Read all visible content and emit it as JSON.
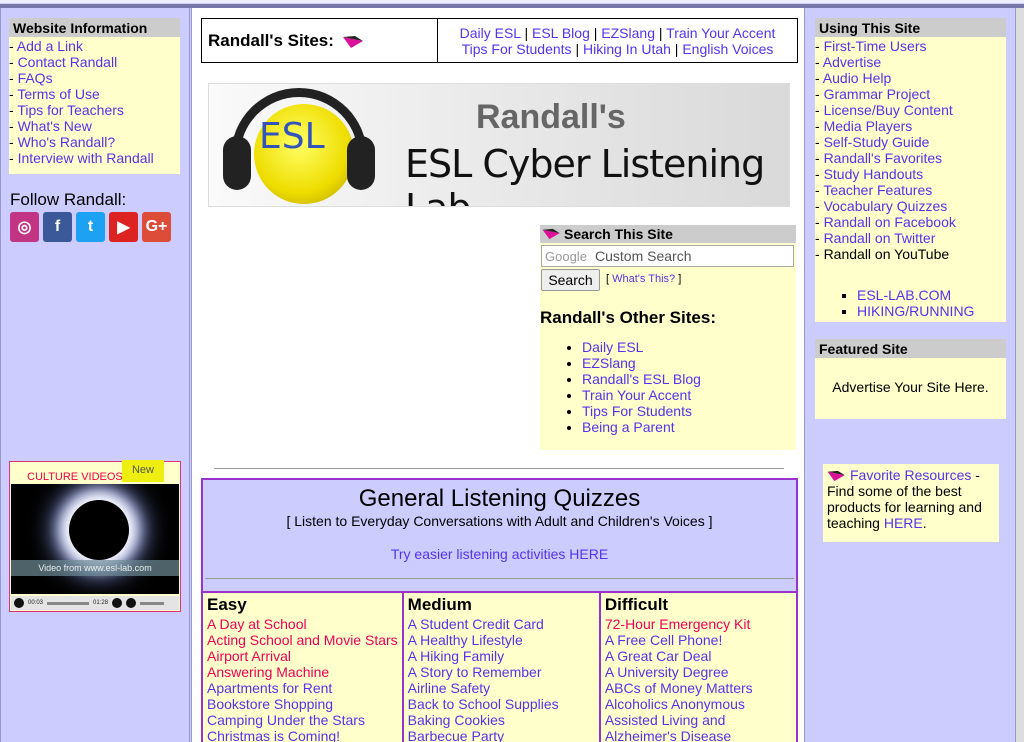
{
  "colors": {
    "page_bg": "#ccccff",
    "link": "#5533ee",
    "pink_link": "#ee0055",
    "yellow": "#ffffcc",
    "header_gray": "#cccccc",
    "quiz_border": "#9933cc"
  },
  "left": {
    "website_info": {
      "heading": "Website Information",
      "items": [
        "Add a Link",
        "Contact Randall",
        "FAQs",
        "Terms of Use",
        "Tips for Teachers",
        "What's New",
        "Who's Randall?",
        "Interview with Randall"
      ]
    },
    "follow_label": "Follow Randall:",
    "social_icons": [
      {
        "name": "instagram-icon",
        "glyph": "◎",
        "color": "#c13584"
      },
      {
        "name": "facebook-icon",
        "glyph": "f",
        "color": "#3b5998"
      },
      {
        "name": "twitter-icon",
        "glyph": "t",
        "color": "#1da1f2"
      },
      {
        "name": "youtube-icon",
        "glyph": "▶",
        "color": "#dd2222"
      },
      {
        "name": "googleplus-icon",
        "glyph": "G+",
        "color": "#dd4b39"
      }
    ],
    "video": {
      "label": "CULTURE VIDEOS",
      "badge": "New",
      "caption": "Video from www.esl-lab.com",
      "time_current": "00:03",
      "time_total": "01:28"
    }
  },
  "center": {
    "sites_title": "Randall's Sites",
    "sites_links_row1": [
      "Daily ESL",
      "ESL Blog",
      "EZSlang",
      "Train Your Accent"
    ],
    "sites_links_row2": [
      "Tips For Students",
      "Hiking In Utah",
      "English Voices"
    ],
    "banner": {
      "esl": "ESL",
      "randall": "Randall's",
      "title": "ESL Cyber Listening Lab"
    },
    "search": {
      "heading": "Search This Site",
      "google": "Google",
      "placeholder": "Custom Search",
      "button": "Search",
      "whats_this": "What's This?"
    },
    "other_sites": {
      "heading": "Randall's Other Sites:",
      "items": [
        "Daily ESL",
        "EZSlang",
        "Randall's ESL Blog",
        "Train Your Accent",
        "Tips For Students",
        "Being a Parent"
      ]
    },
    "quizzes": {
      "title": "General Listening Quizzes",
      "subtitle": "[ Listen to Everyday Conversations with Adult and Children's Voices ]",
      "easier": "Try easier listening activities HERE",
      "columns": [
        {
          "heading": "Easy",
          "items": [
            {
              "t": "A Day at School",
              "pink": true
            },
            {
              "t": "Acting School and Movie Stars",
              "pink": true
            },
            {
              "t": "Airport Arrival",
              "pink": true
            },
            {
              "t": "Answering Machine",
              "pink": true
            },
            {
              "t": "Apartments for Rent",
              "pink": false
            },
            {
              "t": "Bookstore Shopping",
              "pink": false
            },
            {
              "t": "Camping Under the Stars",
              "pink": false
            },
            {
              "t": "Christmas is Coming!",
              "pink": false
            }
          ]
        },
        {
          "heading": "Medium",
          "items": [
            {
              "t": "A Student Credit Card",
              "pink": false
            },
            {
              "t": "A Healthy Lifestyle",
              "pink": false
            },
            {
              "t": "A Hiking Family",
              "pink": false
            },
            {
              "t": "A Story to Remember",
              "pink": false
            },
            {
              "t": "Airline Safety",
              "pink": false
            },
            {
              "t": "Back to School Supplies",
              "pink": false
            },
            {
              "t": "Baking Cookies",
              "pink": false
            },
            {
              "t": "Barbecue Party",
              "pink": false
            }
          ]
        },
        {
          "heading": "Difficult",
          "items": [
            {
              "t": "72-Hour Emergency Kit",
              "pink": true
            },
            {
              "t": "A Free Cell Phone!",
              "pink": false
            },
            {
              "t": "A Great Car Deal",
              "pink": false
            },
            {
              "t": "A University Degree",
              "pink": false
            },
            {
              "t": "ABCs of Money Matters",
              "pink": false
            },
            {
              "t": "Alcoholics Anonymous",
              "pink": false
            },
            {
              "t": "Assisted Living and",
              "pink": false
            },
            {
              "t": "Alzheimer's Disease",
              "pink": false
            }
          ]
        }
      ]
    }
  },
  "right": {
    "using": {
      "heading": "Using This Site",
      "items": [
        "First-Time Users",
        "Advertise",
        "Audio Help",
        "Grammar Project",
        "License/Buy Content",
        "Media Players",
        "Self-Study Guide",
        "Randall's Favorites",
        "Study Handouts",
        "Teacher Features",
        "Vocabulary Quizzes",
        "Randall on Facebook",
        "Randall on Twitter"
      ],
      "youtube_item": "Randall on YouTube",
      "sub_items": [
        "ESL-LAB.COM",
        "HIKING/RUNNING"
      ]
    },
    "featured": {
      "heading": "Featured Site",
      "text": "Advertise Your Site Here."
    },
    "favorites": {
      "link": "Favorite Resources",
      "text": " - Find some of the best products for learning and teaching ",
      "here": "HERE"
    }
  }
}
